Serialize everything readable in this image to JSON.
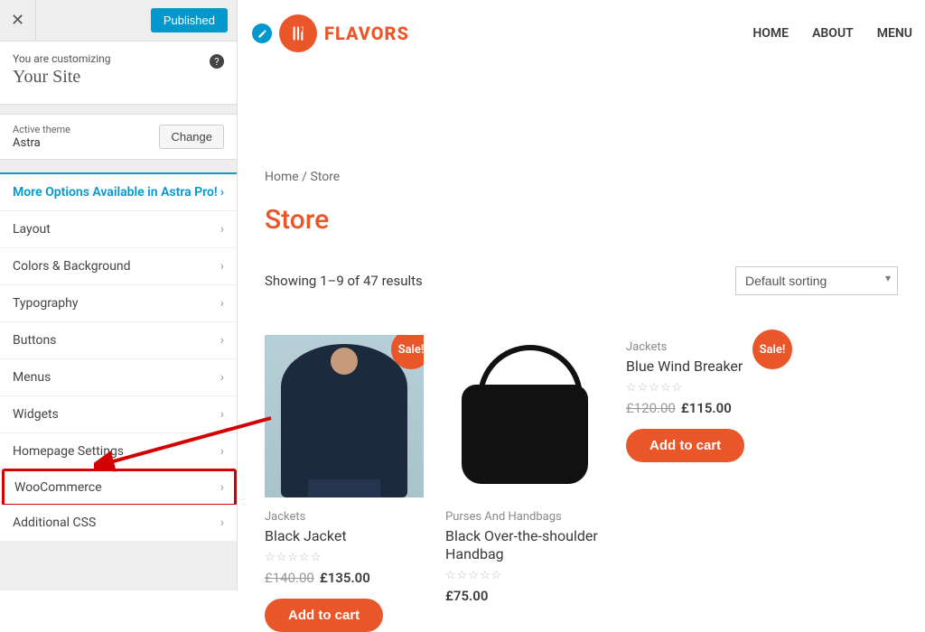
{
  "customizer": {
    "publish_label": "Published",
    "small_label": "You are customizing",
    "site_label": "Your Site",
    "theme_label": "Active theme",
    "theme_name": "Astra",
    "change_label": "Change",
    "promo_label": "More Options Available in Astra Pro!",
    "sections": [
      "Layout",
      "Colors & Background",
      "Typography",
      "Buttons",
      "Menus",
      "Widgets",
      "Homepage Settings",
      "WooCommerce",
      "Additional CSS"
    ]
  },
  "site": {
    "brand": "FLAVORS",
    "nav": [
      "HOME",
      "ABOUT",
      "MENU"
    ]
  },
  "store": {
    "breadcrumb_home": "Home",
    "breadcrumb_sep": "/",
    "breadcrumb_page": "Store",
    "title": "Store",
    "result_text": "Showing 1–9 of 47 results",
    "sort_label": "Default sorting",
    "sale_label": "Sale!",
    "add_label": "Add to cart",
    "products": [
      {
        "cat": "Jackets",
        "name": "Black Jacket",
        "old": "£140.00",
        "cur": "£135.00",
        "sale": true,
        "img": "jacket"
      },
      {
        "cat": "Purses And Handbags",
        "name": "Black Over-the-shoulder Handbag",
        "old": "",
        "cur": "£75.00",
        "sale": false,
        "img": "bag"
      },
      {
        "cat": "Jackets",
        "name": "Blue Wind Breaker",
        "old": "£120.00",
        "cur": "£115.00",
        "sale": true,
        "img": "none"
      }
    ]
  }
}
